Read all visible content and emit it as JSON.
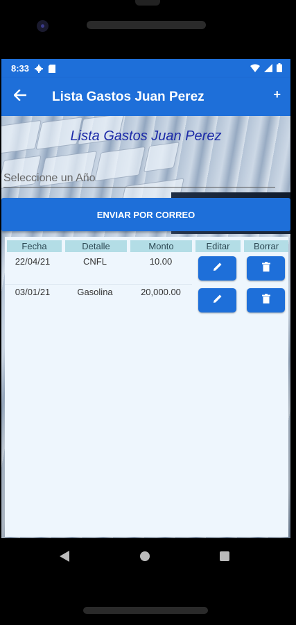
{
  "status_bar": {
    "time": "8:33"
  },
  "app_bar": {
    "title": "Lista Gastos Juan Perez",
    "add_label": "+"
  },
  "heading": "Lista Gastos Juan Perez",
  "year_select": {
    "placeholder": "Seleccione un Año"
  },
  "send_button": "ENVIAR POR CORREO",
  "table": {
    "headers": [
      "Fecha",
      "Detalle",
      "Monto",
      "Editar",
      "Borrar"
    ],
    "rows": [
      {
        "fecha": "22/04/21",
        "detalle": "CNFL",
        "monto": "10.00"
      },
      {
        "fecha": "03/01/21",
        "detalle": "Gasolina",
        "monto": "20,000.00"
      }
    ]
  },
  "colors": {
    "primary": "#1e6fd9",
    "header_cell": "#b3dde6",
    "heading_text": "#1c2aa8"
  },
  "icons": [
    "settings-icon",
    "sim-icon",
    "wifi-icon",
    "signal-icon",
    "battery-icon",
    "back-arrow-icon",
    "edit-icon",
    "delete-icon"
  ]
}
